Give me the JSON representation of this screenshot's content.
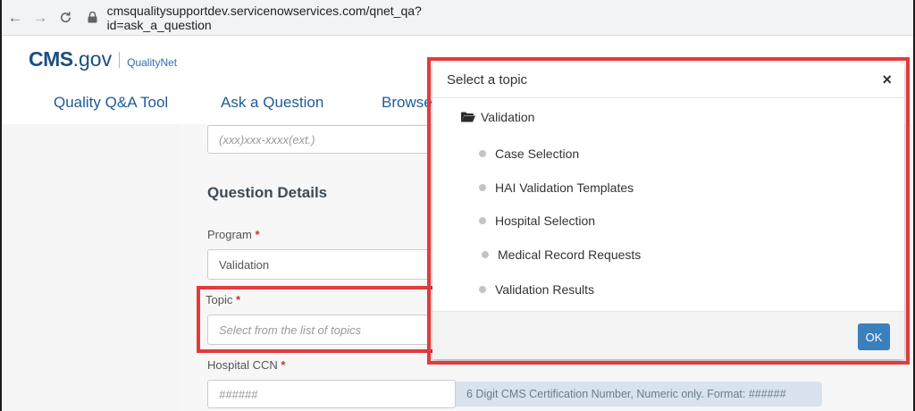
{
  "browser": {
    "url": "cmsqualitysupportdev.servicenowservices.com/qnet_qa?id=ask_a_question",
    "back_icon": "back-arrow-icon",
    "forward_icon": "forward-arrow-icon",
    "reload_icon": "reload-icon",
    "lock_icon": "lock-icon"
  },
  "header": {
    "logo_cms": "CMS",
    "logo_gov": ".gov",
    "logo_qualitynet": "QualityNet"
  },
  "nav": {
    "items": [
      "Quality Q&A Tool",
      "Ask a Question",
      "Browse"
    ]
  },
  "form": {
    "phone_placeholder": "(xxx)xxx-xxxx(ext.)",
    "section_title": "Question Details",
    "program_label": "Program",
    "program_value": "Validation",
    "topic_label": "Topic",
    "topic_placeholder": "Select from the list of topics",
    "ccn_label": "Hospital CCN",
    "ccn_placeholder": "######",
    "ccn_hint": "6 Digit CMS Certification Number, Numeric only. Format: ######",
    "required_mark": "*"
  },
  "modal": {
    "title": "Select a topic",
    "close": "×",
    "folder": "Validation",
    "topics": [
      "Case Selection",
      "HAI Validation Templates",
      "Hospital Selection",
      "Medical Record Requests",
      "Validation Results"
    ],
    "ok_label": "OK"
  },
  "colors": {
    "brand_blue": "#1b4e85",
    "highlight_red": "#e23b3b",
    "ok_button": "#3a7fbe"
  }
}
